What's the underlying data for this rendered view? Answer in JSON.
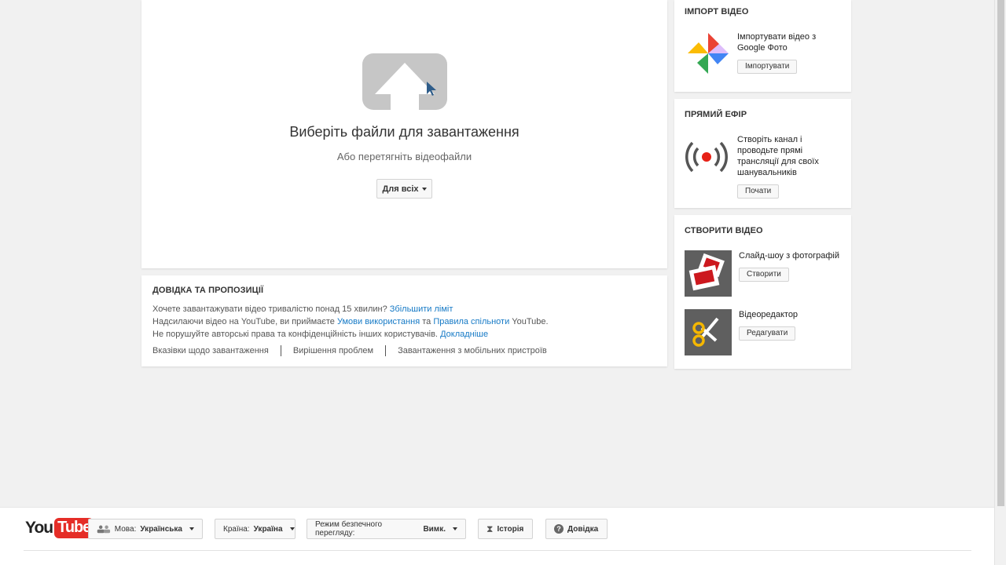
{
  "upload": {
    "title": "Виберіть файли для завантаження",
    "subtitle": "Або перетягніть відеофайли",
    "privacy_label": "Для всіх"
  },
  "help": {
    "title": "ДОВІДКА ТА ПРОПОЗИЦІЇ",
    "line1_text": "Хочете завантажувати відео тривалістю понад 15 хвилин?",
    "line1_link": "Збільшити ліміт",
    "line2_pre": "Надсилаючи відео на YouTube, ви приймаєте",
    "line2_link1": "Умови використання",
    "line2_mid": "та",
    "line2_link2": "Правила спільноти",
    "line2_post": "YouTube.",
    "line3_text": "Не порушуйте авторські права та конфіденційність інших користувачів.",
    "line3_link": "Докладніше",
    "links": [
      "Вказівки щодо завантаження",
      "Вирішення проблем",
      "Завантаження з мобільних пристроїв"
    ]
  },
  "import": {
    "title": "ІМПОРТ ВІДЕО",
    "text": "Імпортувати відео з Google Фото",
    "button": "Імпортувати"
  },
  "live": {
    "title": "ПРЯМИЙ ЕФІР",
    "text": "Створіть канал і проводьте прямі трансляції для своїх шанувальників",
    "button": "Почати"
  },
  "create": {
    "title": "СТВОРИТИ ВІДЕО",
    "slideshow_text": "Слайд-шоу з фотографій",
    "slideshow_button": "Створити",
    "editor_text": "Відеоредактор",
    "editor_button": "Редагувати"
  },
  "footer": {
    "logo_you": "You",
    "logo_tube": "Tube",
    "language_label": "Мова:",
    "language_value": "Українська",
    "country_label": "Країна:",
    "country_value": "Україна",
    "safety_label": "Режим безпечного перегляду:",
    "safety_value": "Вимк.",
    "history": "Історія",
    "help": "Довідка"
  },
  "colors": {
    "link": "#167ac6",
    "youtube_red": "#e52d27",
    "live_red": "#e62117"
  }
}
